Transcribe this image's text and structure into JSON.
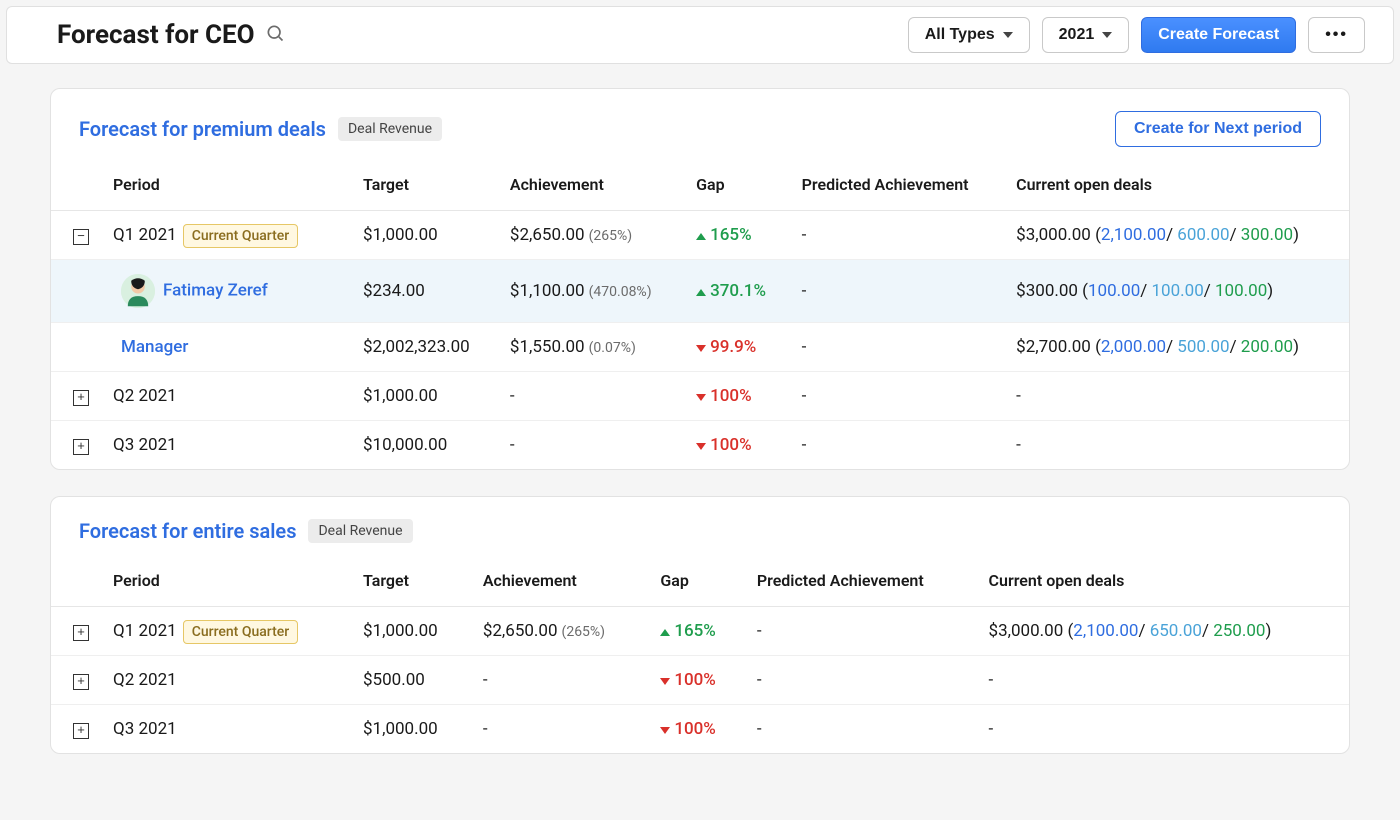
{
  "header": {
    "title": "Forecast for CEO",
    "type_filter": "All Types",
    "year_filter": "2021",
    "create_btn": "Create Forecast"
  },
  "columns": {
    "period": "Period",
    "target": "Target",
    "achievement": "Achievement",
    "gap": "Gap",
    "predicted": "Predicted Achievement",
    "open_deals": "Current open deals"
  },
  "labels": {
    "current_quarter": "Current Quarter",
    "create_next": "Create for Next period",
    "deal_revenue": "Deal Revenue"
  },
  "sections": [
    {
      "title": "Forecast for premium deals",
      "show_create_next": true,
      "rows": [
        {
          "type": "period",
          "toggle": "minus",
          "period": "Q1 2021",
          "current": true,
          "target": "$1,000.00",
          "achievement": "$2,650.00",
          "achievement_pct": "(265%)",
          "gap_dir": "up",
          "gap": "165%",
          "predicted": "-",
          "deals_total": "$3,000.00",
          "deals_a": "2,100.00",
          "deals_b": "600.00",
          "deals_c": "300.00"
        },
        {
          "type": "user",
          "highlight": true,
          "name": "Fatimay Zeref",
          "target": "$234.00",
          "achievement": "$1,100.00",
          "achievement_pct": "(470.08%)",
          "gap_dir": "up",
          "gap": "370.1%",
          "predicted": "-",
          "deals_total": "$300.00",
          "deals_a": "100.00",
          "deals_b": "100.00",
          "deals_c": "100.00"
        },
        {
          "type": "user",
          "name": "Manager",
          "target": "$2,002,323.00",
          "achievement": "$1,550.00",
          "achievement_pct": "(0.07%)",
          "gap_dir": "down",
          "gap": "99.9%",
          "predicted": "-",
          "deals_total": "$2,700.00",
          "deals_a": "2,000.00",
          "deals_b": "500.00",
          "deals_c": "200.00"
        },
        {
          "type": "period",
          "toggle": "plus",
          "period": "Q2 2021",
          "target": "$1,000.00",
          "achievement": "-",
          "gap_dir": "down",
          "gap": "100%",
          "predicted": "-",
          "open_deals_raw": "-"
        },
        {
          "type": "period",
          "toggle": "plus",
          "period": "Q3 2021",
          "target": "$10,000.00",
          "achievement": "-",
          "gap_dir": "down",
          "gap": "100%",
          "predicted": "-",
          "open_deals_raw": "-"
        }
      ]
    },
    {
      "title": "Forecast for entire sales",
      "show_create_next": false,
      "rows": [
        {
          "type": "period",
          "toggle": "plus",
          "period": "Q1 2021",
          "current": true,
          "target": "$1,000.00",
          "achievement": "$2,650.00",
          "achievement_pct": "(265%)",
          "gap_dir": "up",
          "gap": "165%",
          "predicted": "-",
          "deals_total": "$3,000.00",
          "deals_a": "2,100.00",
          "deals_b": "650.00",
          "deals_c": "250.00"
        },
        {
          "type": "period",
          "toggle": "plus",
          "period": "Q2 2021",
          "target": "$500.00",
          "achievement": "-",
          "gap_dir": "down",
          "gap": "100%",
          "predicted": "-",
          "open_deals_raw": "-"
        },
        {
          "type": "period",
          "toggle": "plus",
          "period": "Q3 2021",
          "target": "$1,000.00",
          "achievement": "-",
          "gap_dir": "down",
          "gap": "100%",
          "predicted": "-",
          "open_deals_raw": "-"
        }
      ]
    }
  ]
}
